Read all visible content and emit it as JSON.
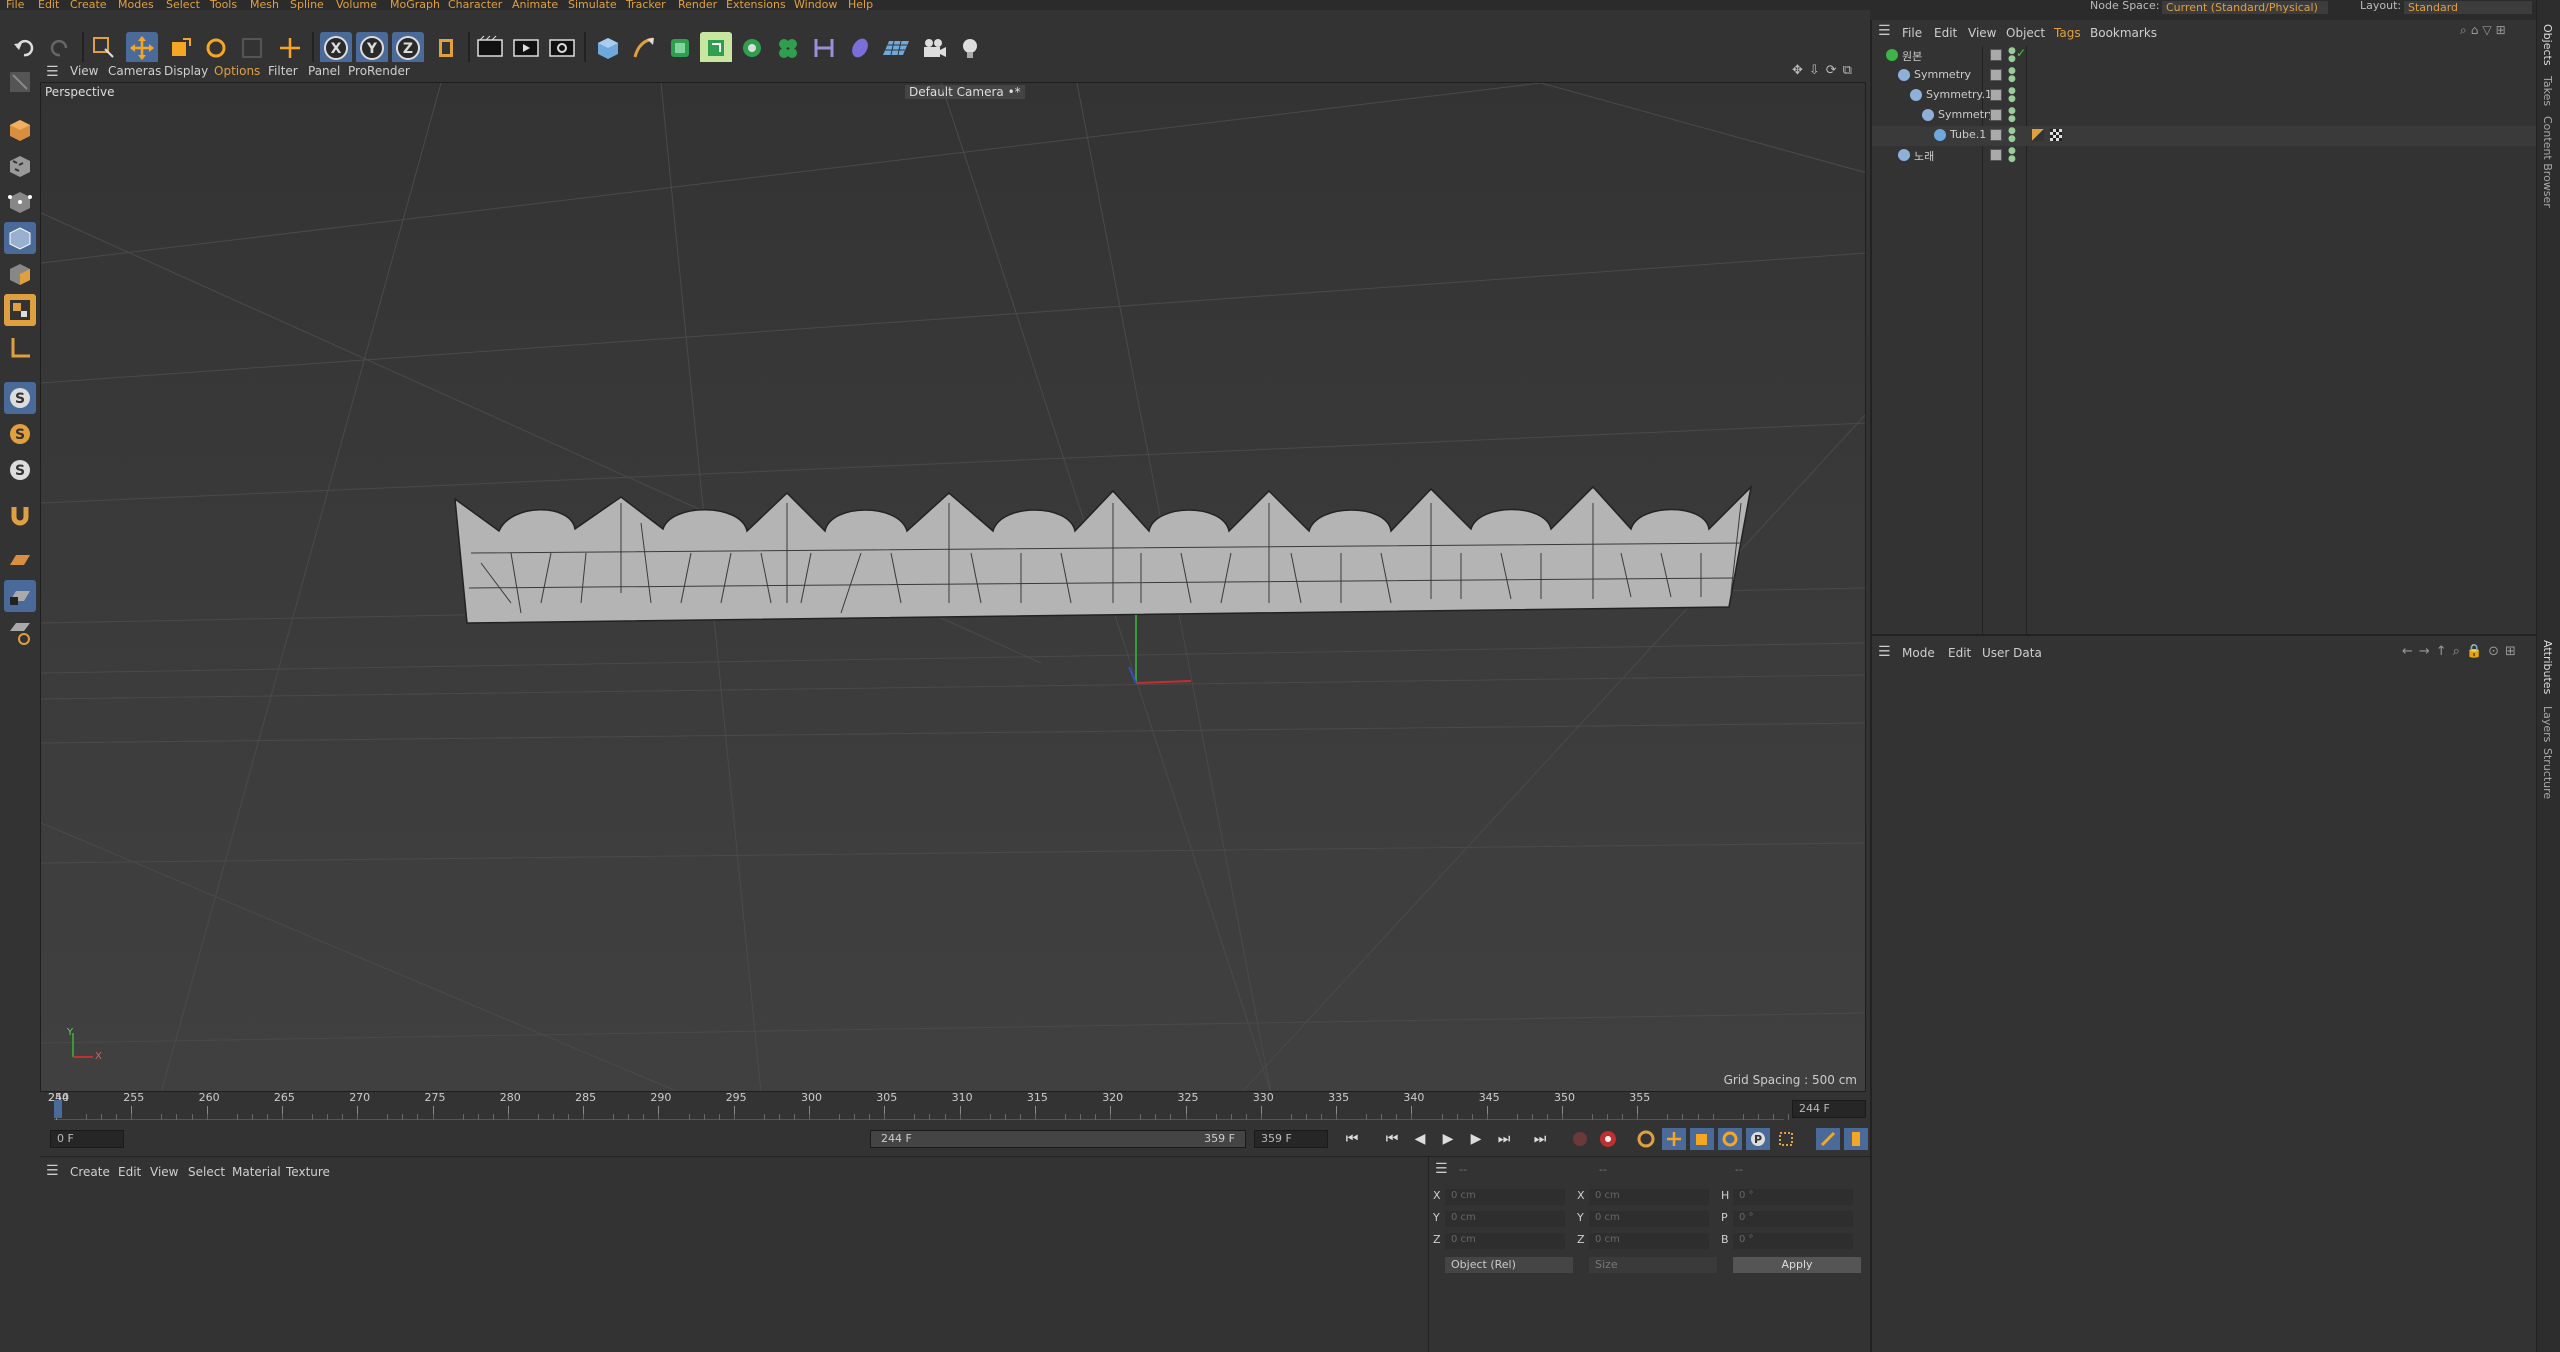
{
  "menubar": [
    "File",
    "Edit",
    "Create",
    "Modes",
    "Select",
    "Tools",
    "Mesh",
    "Spline",
    "Volume",
    "MoGraph",
    "Character",
    "Animate",
    "Simulate",
    "Tracker",
    "Render",
    "Extensions",
    "Window",
    "Help"
  ],
  "topright": {
    "node_space_label": "Node Space:",
    "node_space_value": "Current (Standard/Physical)",
    "layout_label": "Layout:",
    "layout_value": "Standard"
  },
  "viewport": {
    "menu": [
      "View",
      "Cameras",
      "Display",
      "Options",
      "Filter",
      "Panel",
      "ProRender"
    ],
    "view_name": "Perspective",
    "camera": "Default Camera •*",
    "grid_spacing": "Grid Spacing : 500 cm",
    "axis_x": "X",
    "axis_y": "Y"
  },
  "timeline": {
    "ticks": [
      "244",
      "250",
      "255",
      "260",
      "265",
      "270",
      "275",
      "280",
      "285",
      "290",
      "295",
      "300",
      "305",
      "310",
      "315",
      "320",
      "325",
      "330",
      "335",
      "340",
      "345",
      "350",
      "355"
    ],
    "current_frame": "244 F",
    "start_field": "0 F",
    "range_start": "244 F",
    "range_end": "359 F",
    "end_field": "359 F"
  },
  "material": {
    "menu": [
      "Create",
      "Edit",
      "View",
      "Select",
      "Material",
      "Texture"
    ]
  },
  "coords": {
    "col_headers": [
      "--",
      "--",
      "--"
    ],
    "rows": [
      {
        "a": "X",
        "av": "0 cm",
        "b": "X",
        "bv": "0 cm",
        "c": "H",
        "cv": "0 °"
      },
      {
        "a": "Y",
        "av": "0 cm",
        "b": "Y",
        "bv": "0 cm",
        "c": "P",
        "cv": "0 °"
      },
      {
        "a": "Z",
        "av": "0 cm",
        "b": "Z",
        "bv": "0 cm",
        "c": "B",
        "cv": "0 °"
      }
    ],
    "mode": "Object (Rel)",
    "size": "Size",
    "apply": "Apply"
  },
  "objects": {
    "menu": [
      "File",
      "Edit",
      "View",
      "Object",
      "Tags",
      "Bookmarks"
    ],
    "items": [
      {
        "name": "원본",
        "indent": 0
      },
      {
        "name": "Symmetry",
        "indent": 1
      },
      {
        "name": "Symmetry.1",
        "indent": 2
      },
      {
        "name": "Symmetry",
        "indent": 3
      },
      {
        "name": "Tube.1",
        "indent": 4
      },
      {
        "name": "노래",
        "indent": 1
      }
    ]
  },
  "attributes": {
    "menu": [
      "Mode",
      "Edit",
      "User Data"
    ]
  },
  "side_tabs_top": [
    "Objects",
    "Takes",
    "Content Browser"
  ],
  "side_tabs_bottom": [
    "Attributes",
    "Layers",
    "Structure"
  ],
  "colors": {
    "accent": "#e0a040",
    "selection": "#4a6a9a",
    "mesh": "#b4b4b4"
  }
}
